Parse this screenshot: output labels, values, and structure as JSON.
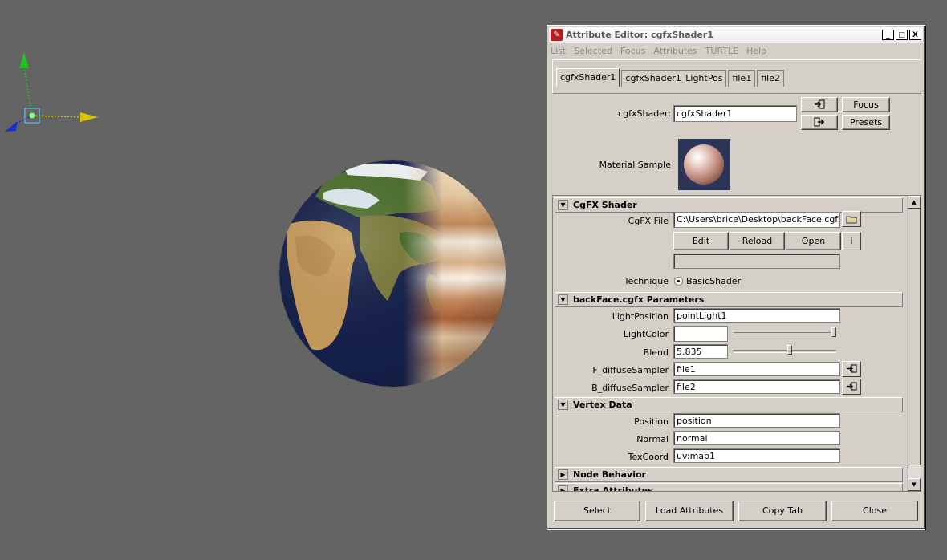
{
  "window": {
    "title": "Attribute Editor: cgfxShader1",
    "controls": [
      "_",
      "□",
      "X"
    ]
  },
  "menu": [
    "List",
    "Selected",
    "Focus",
    "Attributes",
    "TURTLE",
    "Help"
  ],
  "tabs": [
    {
      "label": "cgfxShader1",
      "active": true
    },
    {
      "label": "cgfxShader1_LightPos",
      "active": false
    },
    {
      "label": "file1",
      "active": false
    },
    {
      "label": "file2",
      "active": false
    }
  ],
  "shader": {
    "label": "cgfxShader:",
    "value": "cgfxShader1",
    "focus_label": "Focus",
    "presets_label": "Presets",
    "material_sample_label": "Material Sample"
  },
  "cgfx_section": {
    "title": "CgFX Shader",
    "file_label": "CgFX File",
    "file_value": "C:\\Users\\brice\\Desktop\\backFace.cgfx",
    "edit_label": "Edit",
    "reload_label": "Reload",
    "open_label": "Open",
    "info_glyph": "i",
    "technique_label": "Technique",
    "technique_value": "BasicShader"
  },
  "params_section": {
    "title": "backFace.cgfx Parameters",
    "light_position_label": "LightPosition",
    "light_position_value": "pointLight1",
    "light_color_label": "LightColor",
    "light_color_hex": "#ffffff",
    "light_color_slider": 1.0,
    "blend_label": "Blend",
    "blend_value": "5.835",
    "blend_slider": 0.55,
    "f_sampler_label": "F_diffuseSampler",
    "f_sampler_value": "file1",
    "b_sampler_label": "B_diffuseSampler",
    "b_sampler_value": "file2"
  },
  "vertex_section": {
    "title": "Vertex Data",
    "position_label": "Position",
    "position_value": "position",
    "normal_label": "Normal",
    "normal_value": "normal",
    "texcoord_label": "TexCoord",
    "texcoord_value": "uv:map1"
  },
  "node_behavior_title": "Node Behavior",
  "extra_attributes_title": "Extra Attributes",
  "bottom_buttons": {
    "select": "Select",
    "load_attributes": "Load Attributes",
    "copy_tab": "Copy Tab",
    "close": "Close"
  },
  "colors": {
    "viewport_bg": "#646464",
    "panel_bg": "#d4d0c8",
    "gizmo_y": "#22c322",
    "gizmo_x": "#d8c400",
    "gizmo_z": "#1a2fd0"
  }
}
